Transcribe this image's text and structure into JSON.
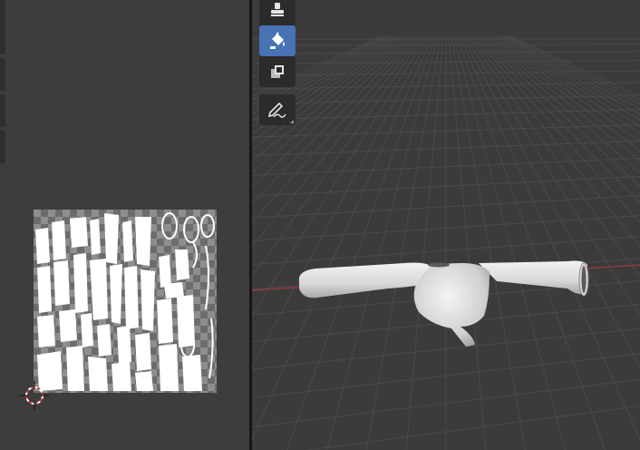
{
  "image_editor": {
    "uv_image": {
      "icon": "uv-texture-map"
    },
    "cursor": {
      "icon": "2d-cursor-icon"
    }
  },
  "viewport": {
    "background_color": "#3b3b3b",
    "x_axis_color": "#8f3a44",
    "toolbar": {
      "tools": [
        {
          "name": "stamp-tool",
          "icon": "stamp-icon",
          "active": false
        },
        {
          "name": "fill-tool",
          "icon": "paint-bucket-icon",
          "active": true
        },
        {
          "name": "clone-tool",
          "icon": "clone-icon",
          "active": false
        },
        {
          "name": "annotate-tool",
          "icon": "pencil-annotate-icon",
          "active": false
        }
      ]
    },
    "object": {
      "icon": "shirt-mesh-object"
    }
  }
}
